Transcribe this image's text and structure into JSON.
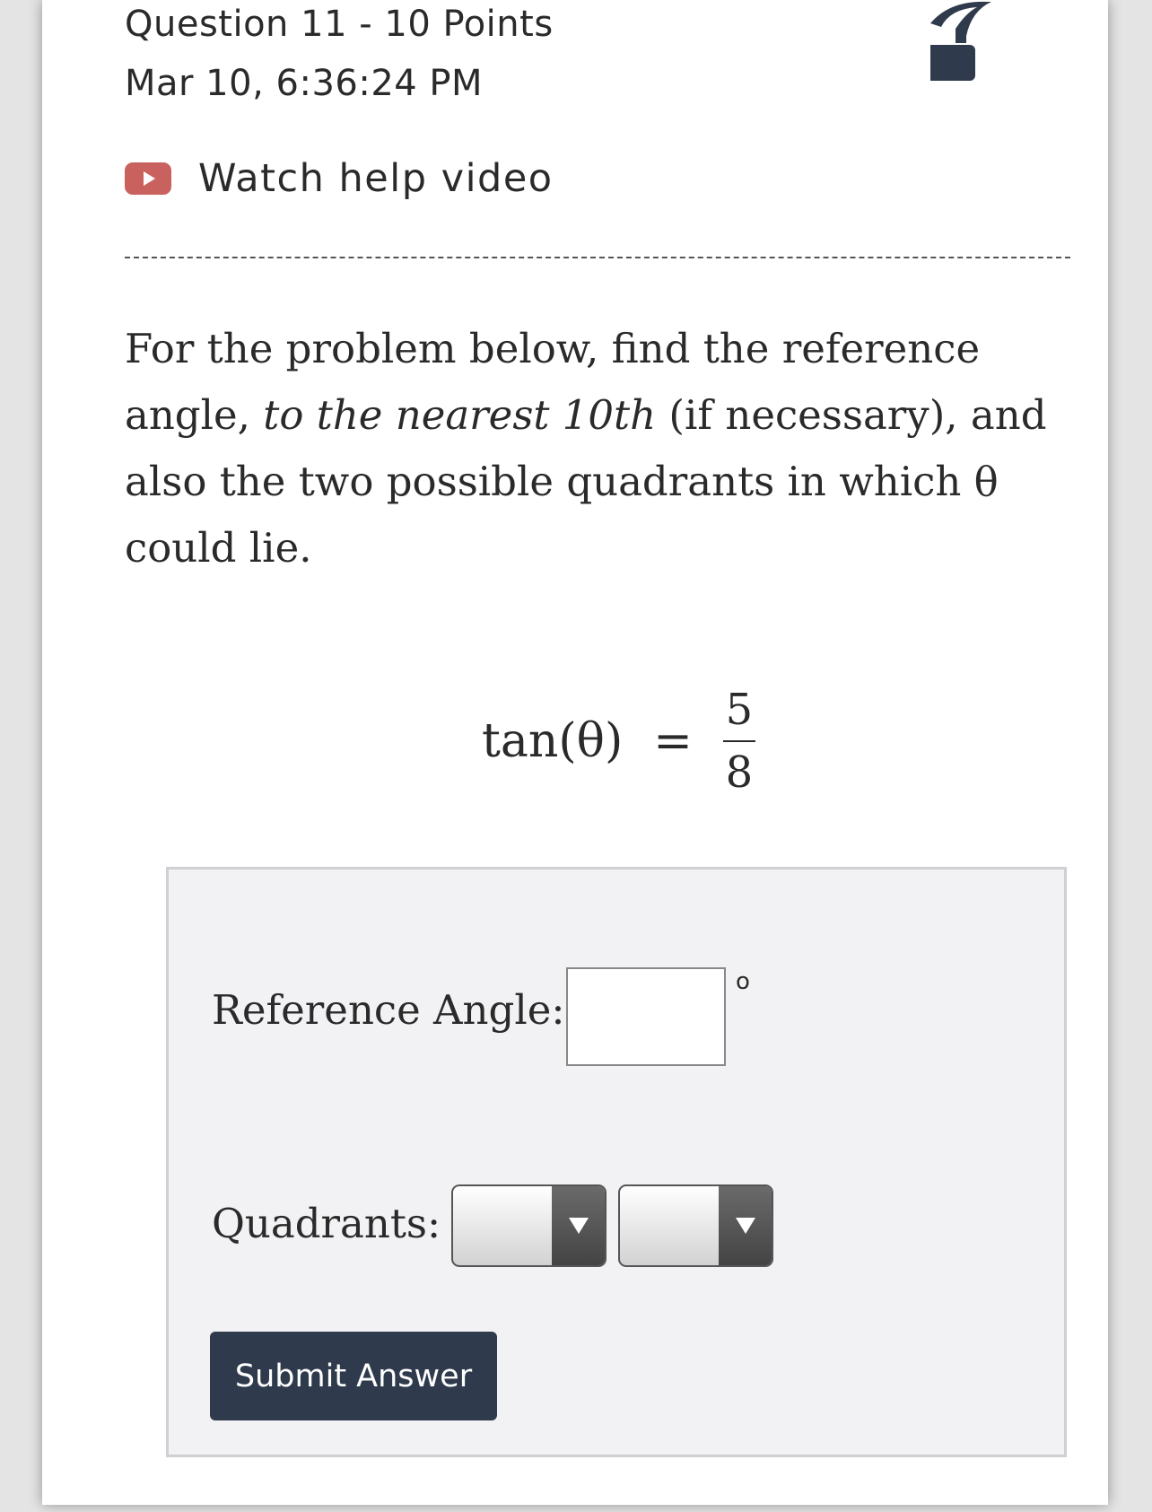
{
  "question": {
    "title": "Question 11 - 10 Points",
    "timestamp": "Mar 10, 6:36:24 PM"
  },
  "help": {
    "icon": "help-question-icon",
    "video_icon": "video-play-icon",
    "video_color": "#c9625f",
    "video_label": "Watch help video"
  },
  "problem": {
    "text_before": "For the problem below, find the reference angle, ",
    "text_italic": "to the nearest 10th",
    "text_after": " (if necessary), and also the two possible quadrants in which θ could lie."
  },
  "equation": {
    "lhs": "tan(θ)",
    "sign": "=",
    "numerator": "5",
    "denominator": "8"
  },
  "answer": {
    "reference_label": "Reference Angle:",
    "reference_value": "",
    "degree_symbol": "o",
    "quadrants_label": "Quadrants:",
    "quadrant_1_value": "",
    "quadrant_2_value": "",
    "submit_label": "Submit Answer",
    "submit_color": "#2f3b4c"
  }
}
